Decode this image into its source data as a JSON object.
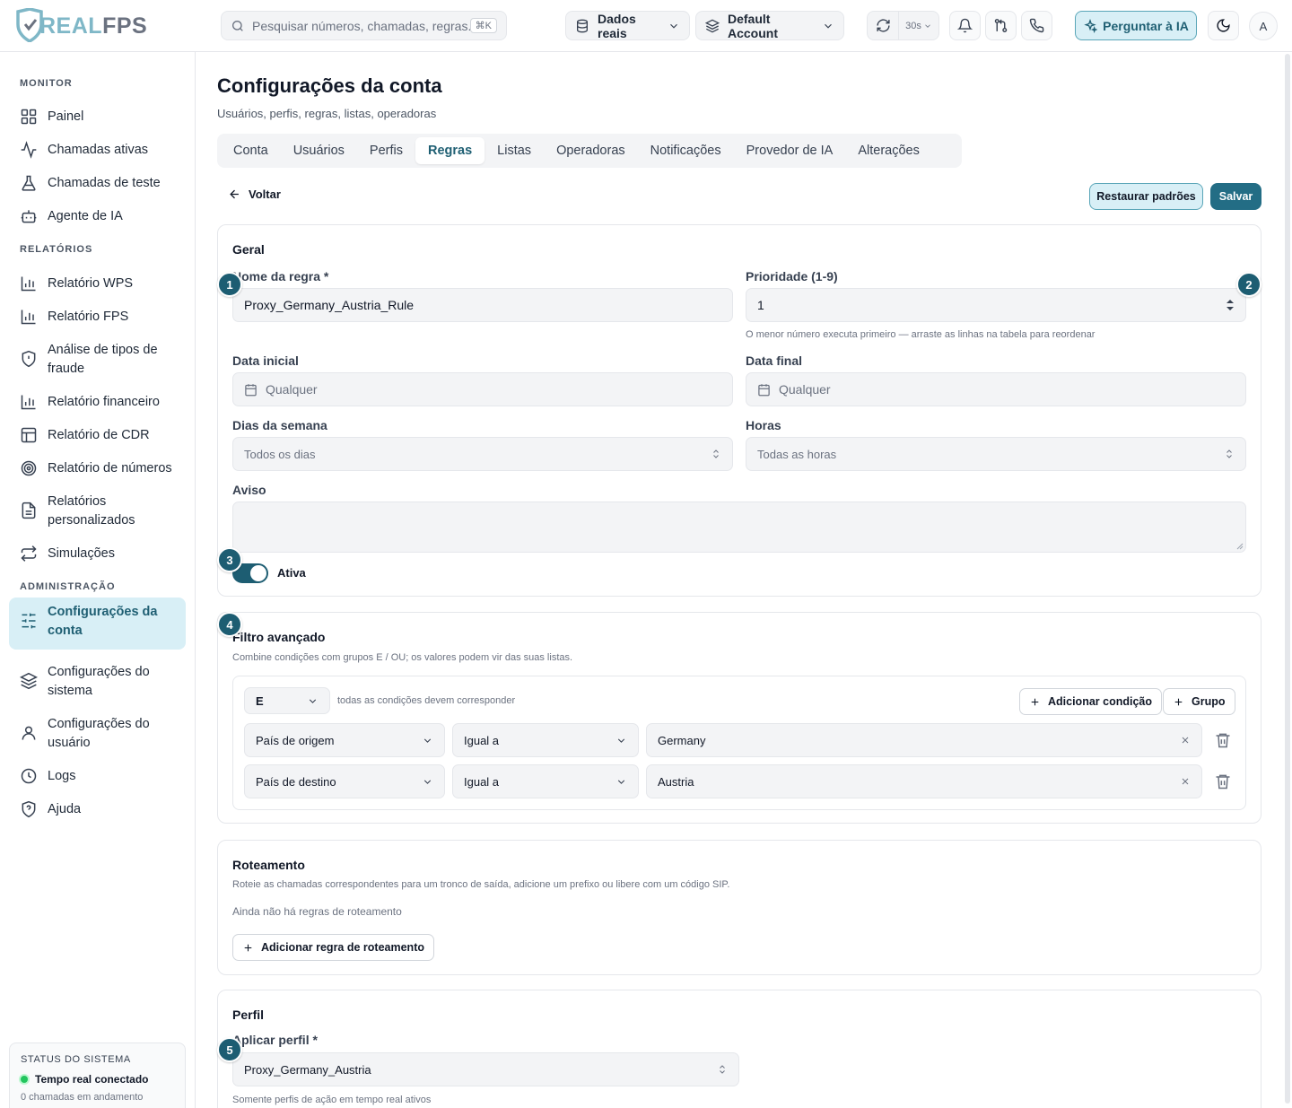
{
  "app": {
    "logo_prefix": "REAL",
    "logo_suffix": "FPS"
  },
  "topbar": {
    "search_placeholder": "Pesquisar números, chamadas, regras...",
    "search_shortcut": "⌘K",
    "data_source": "Dados reais",
    "account": "Default Account",
    "refresh_interval": "30s",
    "ask_ai": "Perguntar à IA",
    "avatar_initial": "A"
  },
  "sidebar": {
    "sections": [
      {
        "title": "MONITOR",
        "items": [
          {
            "label": "Painel",
            "icon": "grid-icon"
          },
          {
            "label": "Chamadas ativas",
            "icon": "activity-icon"
          },
          {
            "label": "Chamadas de teste",
            "icon": "flask-icon"
          },
          {
            "label": "Agente de IA",
            "icon": "bot-icon"
          }
        ]
      },
      {
        "title": "RELATÓRIOS",
        "items": [
          {
            "label": "Relatório WPS",
            "icon": "bar-chart-icon"
          },
          {
            "label": "Relatório FPS",
            "icon": "bar-chart-icon"
          },
          {
            "label": "Análise de tipos de fraude",
            "icon": "shield-icon"
          },
          {
            "label": "Relatório financeiro",
            "icon": "bar-chart-icon"
          },
          {
            "label": "Relatório de CDR",
            "icon": "table-icon"
          },
          {
            "label": "Relatório de números",
            "icon": "target-icon"
          },
          {
            "label": "Relatórios personalizados",
            "icon": "file-icon"
          },
          {
            "label": "Simulações",
            "icon": "repeat-icon"
          }
        ]
      },
      {
        "title": "ADMINISTRAÇÃO",
        "items": [
          {
            "label": "Configurações da conta",
            "icon": "sliders-icon",
            "active": true
          },
          {
            "label": "Configurações do sistema",
            "icon": "layers-icon"
          },
          {
            "label": "Configurações do usuário",
            "icon": "user-icon"
          },
          {
            "label": "Logs",
            "icon": "clock-icon"
          },
          {
            "label": "Ajuda",
            "icon": "help-shield-icon"
          }
        ]
      }
    ],
    "status": {
      "title": "STATUS DO SISTEMA",
      "connection": "Tempo real conectado",
      "calls": "0 chamadas em andamento"
    }
  },
  "page": {
    "title": "Configurações da conta",
    "subtitle": "Usuários, perfis, regras, listas, operadoras",
    "tabs": [
      "Conta",
      "Usuários",
      "Perfis",
      "Regras",
      "Listas",
      "Operadoras",
      "Notificações",
      "Provedor de IA",
      "Alterações"
    ],
    "active_tab": "Regras",
    "back_label": "Voltar",
    "restore_label": "Restaurar padrões",
    "save_label": "Salvar"
  },
  "general": {
    "title": "Geral",
    "rule_name_label": "Nome da regra *",
    "rule_name_value": "Proxy_Germany_Austria_Rule",
    "priority_label": "Prioridade (1-9)",
    "priority_value": "1",
    "priority_hint": "O menor número executa primeiro — arraste as linhas na tabela para reordenar",
    "start_date_label": "Data inicial",
    "start_date_placeholder": "Qualquer",
    "end_date_label": "Data final",
    "end_date_placeholder": "Qualquer",
    "weekdays_label": "Dias da semana",
    "weekdays_value": "Todos os dias",
    "hours_label": "Horas",
    "hours_value": "Todas as horas",
    "warning_label": "Aviso",
    "warning_value": "",
    "active_label": "Ativa",
    "active": true
  },
  "filter": {
    "title": "Filtro avançado",
    "description": "Combine condições com grupos E / OU; os valores podem vir das suas listas.",
    "operator": "E",
    "operator_hint": "todas as condições devem corresponder",
    "add_condition": "Adicionar condição",
    "add_group": "Grupo",
    "conditions": [
      {
        "field": "País de origem",
        "op": "Igual a",
        "value": "Germany"
      },
      {
        "field": "País de destino",
        "op": "Igual a",
        "value": "Austria"
      }
    ]
  },
  "routing": {
    "title": "Roteamento",
    "description": "Roteie as chamadas correspondentes para um tronco de saída, adicione um prefixo ou libere com um código SIP.",
    "empty": "Ainda não há regras de roteamento",
    "add_label": "Adicionar regra de roteamento"
  },
  "profile": {
    "title": "Perfil",
    "apply_label": "Aplicar perfil *",
    "apply_value": "Proxy_Germany_Austria",
    "hint": "Somente perfis de ação em tempo real ativos"
  },
  "badges": [
    "1",
    "2",
    "3",
    "4",
    "5"
  ],
  "colors": {
    "accent": "#1d5d72",
    "accent_light": "#d8eff6",
    "status_ok": "#22c55e"
  }
}
